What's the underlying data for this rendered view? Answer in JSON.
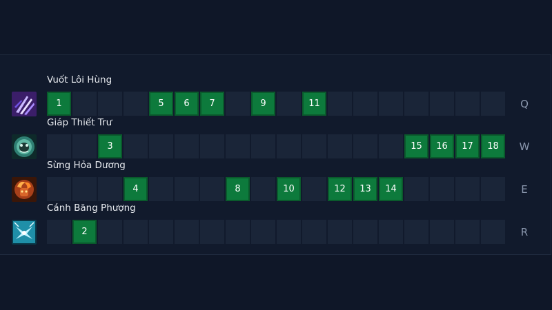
{
  "skills": [
    {
      "name": "Vuốt Lôi Hùng",
      "key": "Q",
      "icon": "claw-lightning-icon",
      "levels": [
        "1",
        "",
        "",
        "",
        "5",
        "6",
        "7",
        "",
        "9",
        "",
        "11",
        "",
        "",
        "",
        "",
        "",
        "",
        ""
      ]
    },
    {
      "name": "Giáp Thiết Trư",
      "key": "W",
      "icon": "boar-armor-icon",
      "levels": [
        "",
        "",
        "3",
        "",
        "",
        "",
        "",
        "",
        "",
        "",
        "",
        "",
        "",
        "",
        "15",
        "16",
        "17",
        "18"
      ]
    },
    {
      "name": "Sừng Hỏa Dương",
      "key": "E",
      "icon": "fire-ram-icon",
      "levels": [
        "",
        "",
        "",
        "4",
        "",
        "",
        "",
        "8",
        "",
        "10",
        "",
        "12",
        "13",
        "14",
        "",
        "",
        "",
        ""
      ]
    },
    {
      "name": "Cánh Băng Phượng",
      "key": "R",
      "icon": "ice-phoenix-icon",
      "levels": [
        "",
        "2",
        "",
        "",
        "",
        "",
        "",
        "",
        "",
        "",
        "",
        "",
        "",
        "",
        "",
        "",
        "",
        ""
      ]
    }
  ],
  "colors": {
    "background": "#0f1728",
    "slot_empty": "#1a2538",
    "slot_active": "#0d7a3c",
    "text": "#e6e9ee",
    "key_text": "#8a97ad"
  }
}
